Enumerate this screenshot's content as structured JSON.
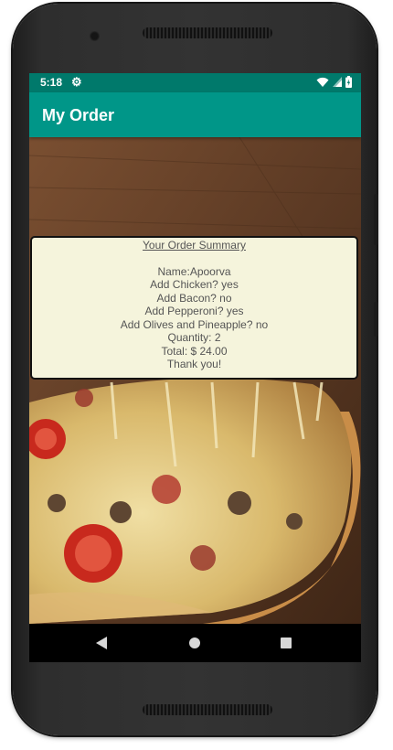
{
  "status_bar": {
    "time": "5:18",
    "settings_icon": "gear-icon",
    "wifi_icon": "wifi-icon",
    "signal_icon": "signal-icon",
    "battery_icon": "battery-icon"
  },
  "app_bar": {
    "title": "My Order"
  },
  "summary": {
    "title": "Your Order Summary",
    "lines": [
      "Name:Apoorva",
      "Add Chicken? yes",
      "Add Bacon? no",
      "Add Pepperoni? yes",
      "Add Olives and Pineapple? no",
      "Quantity: 2",
      "Total: $ 24.00",
      "Thank you!"
    ]
  },
  "nav_bar": {
    "back_icon": "back-triangle-icon",
    "home_icon": "home-circle-icon",
    "recents_icon": "recents-square-icon"
  },
  "colors": {
    "status_bar": "#00796b",
    "app_bar": "#009688",
    "summary_bg": "#f5f4dc"
  }
}
